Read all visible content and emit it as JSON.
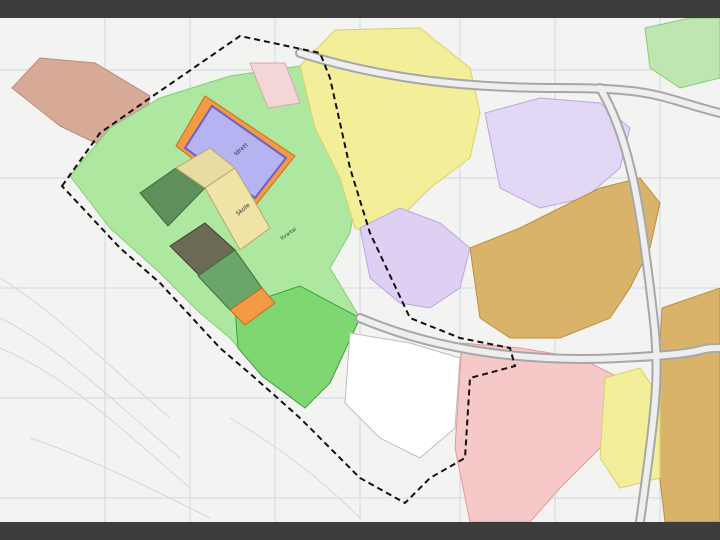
{
  "map": {
    "labels": {
      "hall_label": "Idrett",
      "center_block_label": "Skole",
      "street_label": "Kvartal"
    },
    "colors": {
      "residential_yellow": "#f3ee9a",
      "green_area": "#aee8a0",
      "pink_zone": "#f7c8c8",
      "purple_zone": "#d9c8f0",
      "brown_zone": "#d7b36a",
      "hall_blue": "#b6b3f3",
      "plan_boundary": "#111111"
    }
  }
}
